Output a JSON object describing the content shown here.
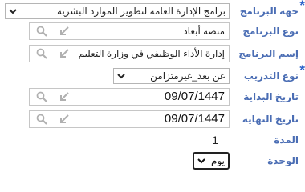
{
  "fields": {
    "program_entity": {
      "label": "جهة البرنامج",
      "required_mark": "*",
      "value": "برامج الإدارة العامة لتطوير الموارد البشرية"
    },
    "program_type": {
      "label": "نوع البرنامج",
      "value": "منصة أبعاد"
    },
    "program_name": {
      "label": "إسم البرنامج",
      "value": "إدارة الأداء الوظيفي في وزارة التعليم"
    },
    "training_type": {
      "label": "نوع التدريب",
      "required_mark": "*",
      "value": "عن بعد_غيرمتزامن"
    },
    "start_date": {
      "label": "تاريخ البداية",
      "value": "09/07/1447"
    },
    "end_date": {
      "label": "تاريخ النهاية",
      "value": "09/07/1447"
    },
    "duration": {
      "label": "المدة",
      "value": "1"
    },
    "unit": {
      "label": "الوحدة",
      "value": "يوم"
    }
  },
  "icons": {
    "search": "search-icon",
    "open": "open-arrow-icon",
    "dropdown": "chevron-down-icon"
  },
  "colors": {
    "label": "#4a6db4",
    "required_star": "#2a61c9",
    "border": "#c6c6c6",
    "icon_grey": "#b0b0b0"
  }
}
